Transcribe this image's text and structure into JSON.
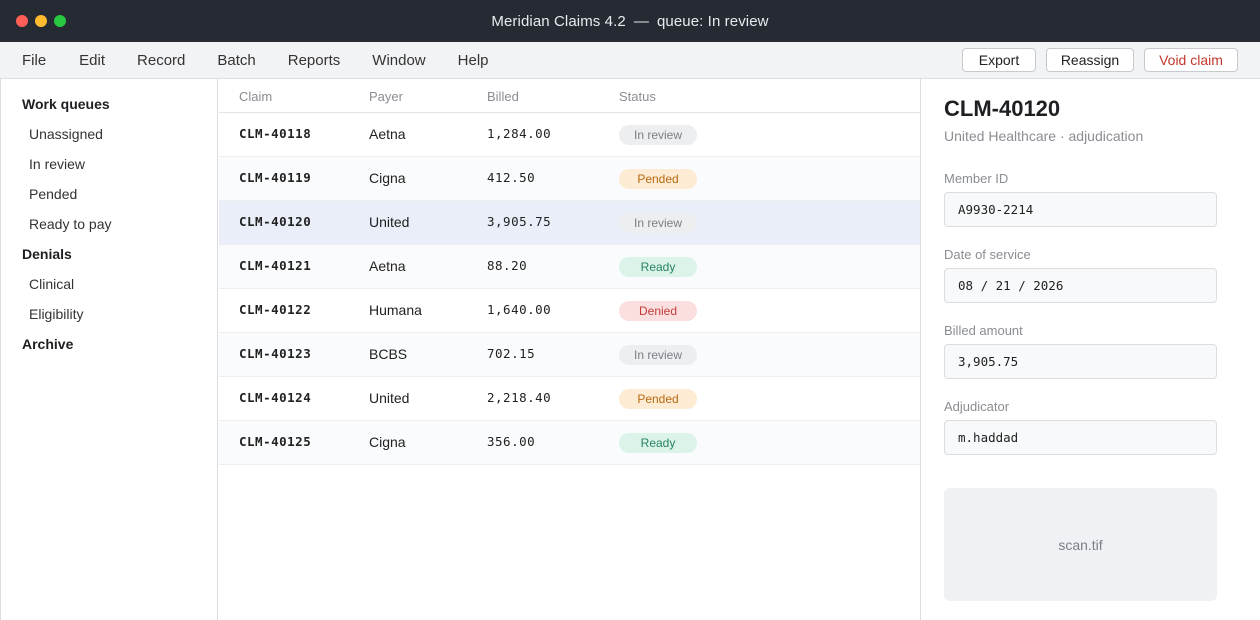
{
  "window": {
    "app_title": "Meridian Claims 4.2",
    "separator": "—",
    "queue_label": "queue: In review"
  },
  "menu": {
    "items": [
      "File",
      "Edit",
      "Record",
      "Batch",
      "Reports",
      "Window",
      "Help"
    ],
    "actions": {
      "export": "Export",
      "reassign": "Reassign",
      "void": "Void claim"
    }
  },
  "sidebar": {
    "sections": [
      {
        "label": "Work queues",
        "items": [
          "Unassigned",
          "In review",
          "Pended",
          "Ready to pay"
        ]
      },
      {
        "label": "Denials",
        "items": [
          "Clinical",
          "Eligibility"
        ]
      },
      {
        "label": "Archive",
        "items": []
      }
    ]
  },
  "table": {
    "columns": [
      "Claim",
      "Payer",
      "Billed",
      "Status"
    ],
    "rows": [
      {
        "claim": "CLM-40118",
        "payer": "Aetna",
        "billed": "1,284.00",
        "status": "In review"
      },
      {
        "claim": "CLM-40119",
        "payer": "Cigna",
        "billed": "412.50",
        "status": "Pended"
      },
      {
        "claim": "CLM-40120",
        "payer": "United",
        "billed": "3,905.75",
        "status": "In review"
      },
      {
        "claim": "CLM-40121",
        "payer": "Aetna",
        "billed": "88.20",
        "status": "Ready"
      },
      {
        "claim": "CLM-40122",
        "payer": "Humana",
        "billed": "1,640.00",
        "status": "Denied"
      },
      {
        "claim": "CLM-40123",
        "payer": "BCBS",
        "billed": "702.15",
        "status": "In review"
      },
      {
        "claim": "CLM-40124",
        "payer": "United",
        "billed": "2,218.40",
        "status": "Pended"
      },
      {
        "claim": "CLM-40125",
        "payer": "Cigna",
        "billed": "356.00",
        "status": "Ready"
      }
    ],
    "selected_claim": "CLM-40120"
  },
  "detail": {
    "title": "CLM-40120",
    "subtitle": "United Healthcare · adjudication",
    "fields": {
      "member_id": {
        "label": "Member ID",
        "value": "A9930-2214"
      },
      "date_of_service": {
        "label": "Date of service",
        "value": "08 / 21 / 2026"
      },
      "billed_amount": {
        "label": "Billed amount",
        "value": "3,905.75"
      },
      "adjudicator": {
        "label": "Adjudicator",
        "value": "m.haddad"
      }
    },
    "attachment": "scan.tif"
  },
  "colors": {
    "titlebar": "#252a33",
    "selected_row": "#e9eef9",
    "void_text": "#c0392b",
    "status_in_review": "#edeef0",
    "status_pended": "#fdebd3",
    "status_ready": "#dcf3ea",
    "status_denied": "#fbdede"
  }
}
